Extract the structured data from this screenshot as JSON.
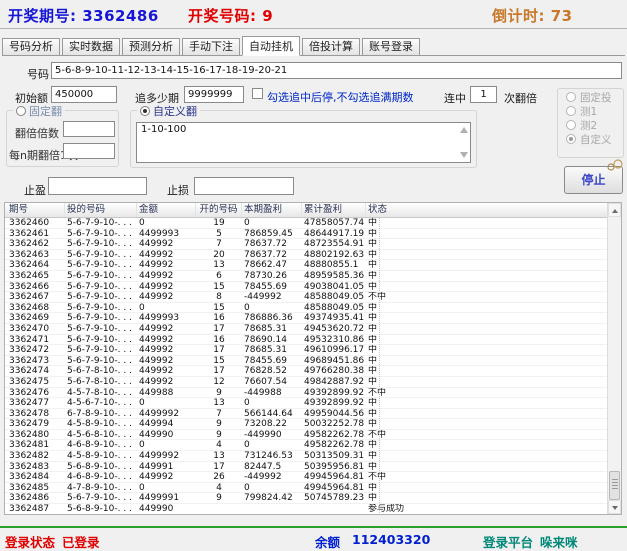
{
  "header": {
    "period_label": "开奖期号:",
    "period_value": "3362486",
    "number_label": "开奖号码:",
    "number_value": "9",
    "countdown_label": "倒计时:",
    "countdown_value": "73"
  },
  "tabs": {
    "items": [
      "号码分析",
      "实时数据",
      "预测分析",
      "手动下注",
      "自动挂机",
      "倍投计算",
      "账号登录"
    ],
    "active": "自动挂机"
  },
  "form": {
    "number_label": "号码",
    "number_value": "5-6-8-9-10-11-12-13-14-15-16-17-18-19-20-21",
    "initial_label": "初始额",
    "initial_value": "450000",
    "chase_label": "追多少期",
    "chase_value": "9999999",
    "checkbox_label": "勾选追中后停,不勾选追满期数",
    "checkbox_checked": false,
    "streak_label": "连中",
    "streak_value": "1",
    "streak_suffix": "次翻倍",
    "fixed_fold": {
      "title": "固定翻",
      "selected": false,
      "multiplier_label": "翻倍倍数",
      "multiplier_value": "",
      "period_label": "每n期翻倍1次",
      "period_value": ""
    },
    "custom_fold": {
      "title": "自定义翻",
      "selected": true,
      "value": "1-10-100"
    },
    "invest_modes": {
      "options": [
        "固定投",
        "测1",
        "测2",
        "自定义"
      ],
      "selected": "自定义"
    },
    "stop_profit_label": "止盈",
    "stop_profit_value": "",
    "stop_loss_label": "止损",
    "stop_loss_value": "",
    "stop_button": "停止"
  },
  "table": {
    "columns": [
      "期号",
      "投的号码",
      "金额",
      "开的号码",
      "本期盈利",
      "累计盈利",
      "状态"
    ],
    "col_keys": [
      "period",
      "numbers",
      "amount",
      "drawn-number",
      "period-profit",
      "cumulative-profit",
      "status"
    ],
    "rows": [
      [
        "3362460",
        "5-6-7-9-10-. . .",
        "0",
        "19",
        "0",
        "47858057.74",
        "中"
      ],
      [
        "3362461",
        "5-6-7-9-10-. . .",
        "4499993",
        "5",
        "786859.45",
        "48644917.19",
        "中"
      ],
      [
        "3362462",
        "5-6-7-9-10-. . .",
        "449992",
        "7",
        "78637.72",
        "48723554.91",
        "中"
      ],
      [
        "3362463",
        "5-6-7-9-10-. . .",
        "449992",
        "20",
        "78637.72",
        "48802192.63",
        "中"
      ],
      [
        "3362464",
        "5-6-7-9-10-. . .",
        "449992",
        "13",
        "78662.47",
        "48880855.1",
        "中"
      ],
      [
        "3362465",
        "5-6-7-9-10-. . .",
        "449992",
        "6",
        "78730.26",
        "48959585.36",
        "中"
      ],
      [
        "3362466",
        "5-6-7-9-10-. . .",
        "449992",
        "15",
        "78455.69",
        "49038041.05",
        "中"
      ],
      [
        "3362467",
        "5-6-7-9-10-. . .",
        "449992",
        "8",
        "-449992",
        "48588049.05",
        "不中"
      ],
      [
        "3362468",
        "5-6-7-9-10-. . .",
        "0",
        "15",
        "0",
        "48588049.05",
        "中"
      ],
      [
        "3362469",
        "5-6-7-9-10-. . .",
        "4499993",
        "16",
        "786886.36",
        "49374935.41",
        "中"
      ],
      [
        "3362470",
        "5-6-7-9-10-. . .",
        "449992",
        "17",
        "78685.31",
        "49453620.72",
        "中"
      ],
      [
        "3362471",
        "5-6-7-9-10-. . .",
        "449992",
        "16",
        "78690.14",
        "49532310.86",
        "中"
      ],
      [
        "3362472",
        "5-6-7-9-10-. . .",
        "449992",
        "17",
        "78685.31",
        "49610996.17",
        "中"
      ],
      [
        "3362473",
        "5-6-7-9-10-. . .",
        "449992",
        "15",
        "78455.69",
        "49689451.86",
        "中"
      ],
      [
        "3362474",
        "5-6-7-8-10-. . .",
        "449992",
        "17",
        "76828.52",
        "49766280.38",
        "中"
      ],
      [
        "3362475",
        "5-6-7-8-10-. . .",
        "449992",
        "12",
        "76607.54",
        "49842887.92",
        "中"
      ],
      [
        "3362476",
        "4-5-7-8-10-. . .",
        "449988",
        "9",
        "-449988",
        "49392899.92",
        "不中"
      ],
      [
        "3362477",
        "4-5-6-7-10-. . .",
        "0",
        "13",
        "0",
        "49392899.92",
        "中"
      ],
      [
        "3362478",
        "6-7-8-9-10-. . .",
        "4499992",
        "7",
        "566144.64",
        "49959044.56",
        "中"
      ],
      [
        "3362479",
        "4-5-8-9-10-. . .",
        "449994",
        "9",
        "73208.22",
        "50032252.78",
        "中"
      ],
      [
        "3362480",
        "4-5-6-8-10-. . .",
        "449990",
        "9",
        "-449990",
        "49582262.78",
        "不中"
      ],
      [
        "3362481",
        "4-6-8-9-10-. . .",
        "0",
        "4",
        "0",
        "49582262.78",
        "中"
      ],
      [
        "3362482",
        "4-5-8-9-10-. . .",
        "4499992",
        "13",
        "731246.53",
        "50313509.31",
        "中"
      ],
      [
        "3362483",
        "5-6-8-9-10-. . .",
        "449991",
        "17",
        "82447.5",
        "50395956.81",
        "中"
      ],
      [
        "3362484",
        "4-6-8-9-10-. . .",
        "449992",
        "26",
        "-449992",
        "49945964.81",
        "不中"
      ],
      [
        "3362485",
        "4-7-8-9-10-. . .",
        "0",
        "4",
        "0",
        "49945964.81",
        "中"
      ],
      [
        "3362486",
        "5-6-7-9-10-. . .",
        "4499991",
        "9",
        "799824.42",
        "50745789.23",
        "中"
      ],
      [
        "3362487",
        "5-6-8-9-10-. . .",
        "449990",
        "",
        "",
        "",
        "参与成功"
      ]
    ]
  },
  "statusbar": {
    "login_label": "登录状态",
    "login_value": "已登录",
    "balance_label": "余额",
    "balance_value": "112403320",
    "platform_label": "登录平台",
    "platform_value": "哚来咪"
  },
  "colors": {
    "accent_blue": "#1616d6",
    "accent_red": "#e00000",
    "accent_orange": "#c87828",
    "link_blue": "#0026c8",
    "balance_blue": "#0020d0",
    "status_teal": "#008878",
    "statusbar_green": "#2ca02c"
  }
}
